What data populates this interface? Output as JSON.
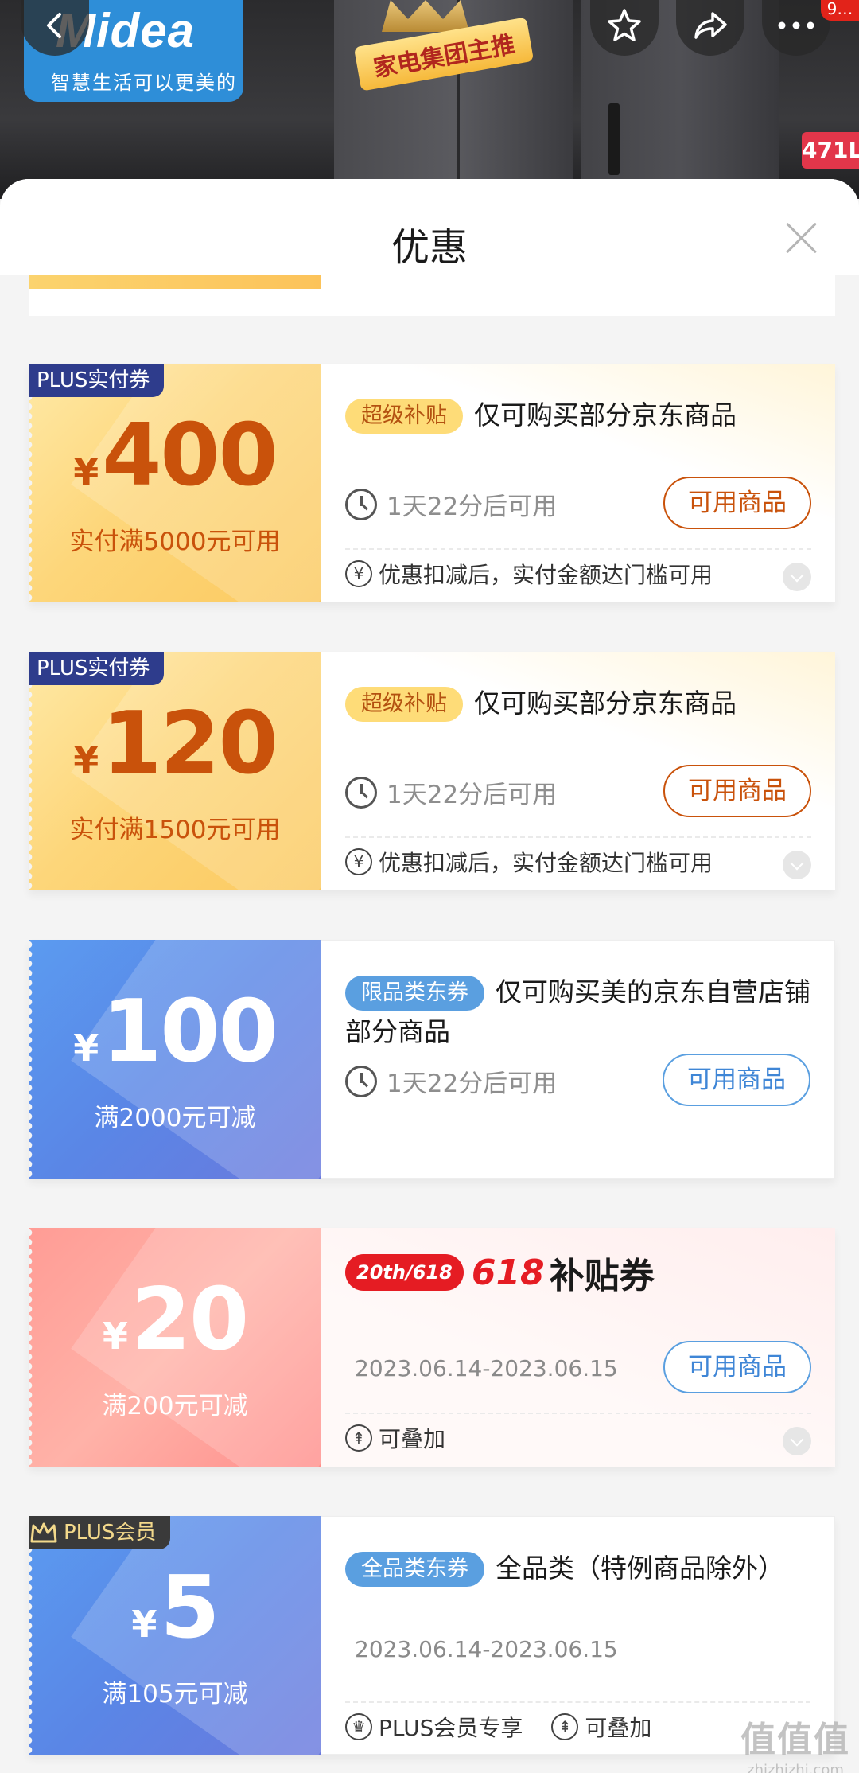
{
  "banner": {
    "brand_name": "Midea",
    "brand_slogan": "智慧生活可以更美的",
    "promo_tag": "家电集团主推",
    "capacity": "471L",
    "badge": "9…"
  },
  "sheet": {
    "title": "优惠"
  },
  "coupons": [
    {
      "tag": "PLUS实付券",
      "yen": "¥",
      "amount": "400",
      "condition": "实付满5000元可用",
      "pill": "超级补贴",
      "title": "仅可购买部分京东商品",
      "time": "1天22分后可用",
      "button": "可用商品",
      "foot": "优惠扣减后，实付金额达门槛可用"
    },
    {
      "tag": "PLUS实付券",
      "yen": "¥",
      "amount": "120",
      "condition": "实付满1500元可用",
      "pill": "超级补贴",
      "title": "仅可购买部分京东商品",
      "time": "1天22分后可用",
      "button": "可用商品",
      "foot": "优惠扣减后，实付金额达门槛可用"
    },
    {
      "yen": "¥",
      "amount": "100",
      "condition": "满2000元可减",
      "pill": "限品类东券",
      "title": "仅可购买美的京东自营店铺部分商品",
      "time": "1天22分后可用",
      "button": "可用商品"
    },
    {
      "yen": "¥",
      "amount": "20",
      "condition": "满200元可减",
      "logo_red": "20th/618",
      "logo_big": "618",
      "logo_text": "补贴券",
      "date": "2023.06.14-2023.06.15",
      "button": "可用商品",
      "foot": "可叠加"
    },
    {
      "tag": "PLUS会员",
      "yen": "¥",
      "amount": "5",
      "condition": "满105元可减",
      "pill": "全品类东券",
      "title": "全品类（特例商品除外）",
      "date": "2023.06.14-2023.06.15",
      "foot_1": "PLUS会员专享",
      "foot_2": "可叠加"
    }
  ],
  "watermark": {
    "main": "值值值",
    "sub": "zhizhizhi.com"
  },
  "colors": {
    "gold_text": "#c9520b",
    "blue_accent": "#5a9fe0",
    "red_618": "#e51c23"
  }
}
